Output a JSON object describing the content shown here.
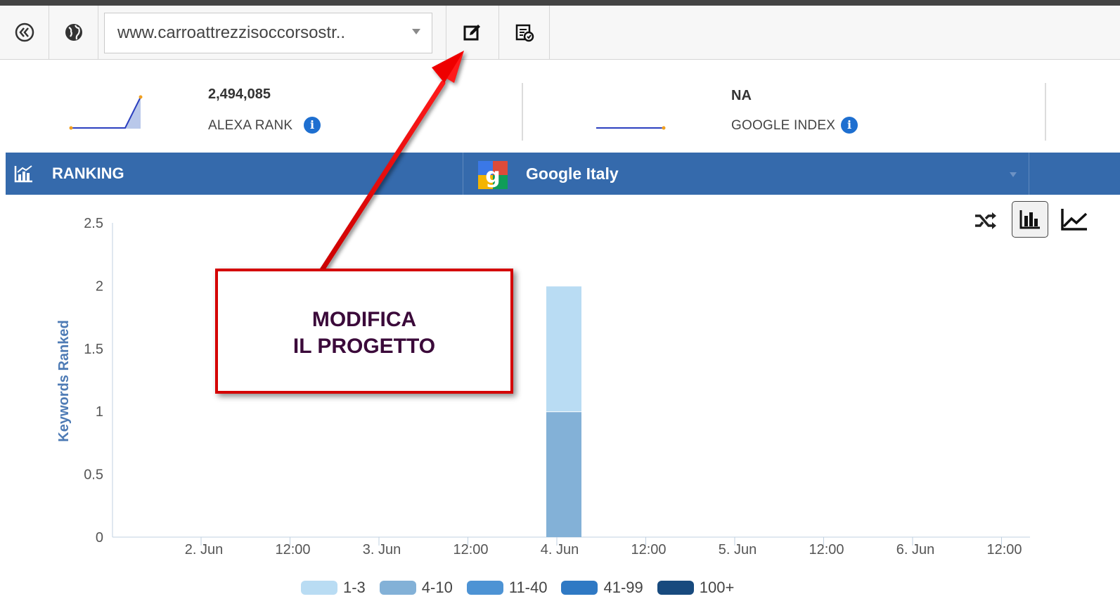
{
  "toolbar": {
    "back_icon": "double-chevron-left-icon",
    "globe_icon": "globe-icon",
    "url_value": "www.carroattrezzisoccorsostr..",
    "edit_icon": "edit-icon",
    "report_icon": "report-settings-icon"
  },
  "metrics": {
    "alexa": {
      "value": "2,494,085",
      "label": "ALEXA RANK"
    },
    "google_index": {
      "value": "NA",
      "label": "GOOGLE INDEX"
    }
  },
  "ranking": {
    "title": "RANKING",
    "engine": "Google Italy",
    "chart_icon": "chart-icon",
    "engine_icon": "google-logo-icon"
  },
  "chart_controls": [
    "shuffle-icon",
    "bar-chart-icon",
    "line-chart-icon"
  ],
  "callout": {
    "line1": "MODIFICA",
    "line2": "IL PROGETTO"
  },
  "colors": {
    "accent": "#356aac",
    "callout_border": "#d40000",
    "s1": "#b9dcf3",
    "s2": "#83b1d7",
    "s3": "#4d93d4",
    "s4": "#2f79c4",
    "s5": "#184a7e"
  },
  "chart_data": {
    "type": "bar",
    "stacked": true,
    "ylabel": "Keywords Ranked",
    "ylim": [
      0,
      2.5
    ],
    "yticks": [
      "0",
      "0.5",
      "1",
      "1.5",
      "2",
      "2.5"
    ],
    "xticks": [
      "2. Jun",
      "12:00",
      "3. Jun",
      "12:00",
      "4. Jun",
      "12:00",
      "5. Jun",
      "12:00",
      "6. Jun",
      "12:00"
    ],
    "categories": [
      "4. Jun"
    ],
    "series": [
      {
        "name": "1-3",
        "values": [
          1
        ]
      },
      {
        "name": "4-10",
        "values": [
          1
        ]
      },
      {
        "name": "11-40",
        "values": [
          0
        ]
      },
      {
        "name": "41-99",
        "values": [
          0
        ]
      },
      {
        "name": "100+",
        "values": [
          0
        ]
      }
    ],
    "legend": "bottom-center"
  }
}
